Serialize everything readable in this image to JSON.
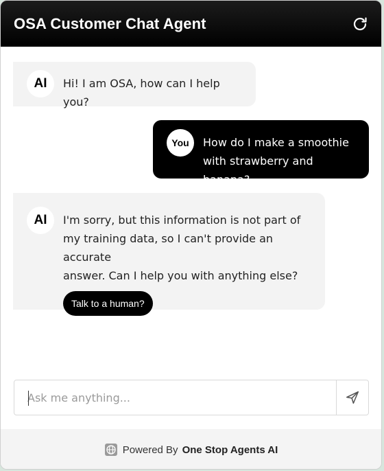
{
  "header": {
    "title": "OSA Customer Chat Agent",
    "refresh_icon": "refresh-icon"
  },
  "messages": [
    {
      "role": "ai",
      "avatar": "AI",
      "text": "Hi! I am OSA, how can I help you?"
    },
    {
      "role": "user",
      "avatar": "You",
      "lines": [
        "How do I make a smoothie",
        "with strawberry and banana?"
      ]
    },
    {
      "role": "ai",
      "avatar": "AI",
      "lines": [
        "I'm sorry, but this information is not part of",
        "my training data, so I can't provide an accurate",
        "answer. Can I help you with anything else?"
      ],
      "action_label": "Talk to a human?"
    }
  ],
  "input": {
    "placeholder": "Ask me anything...",
    "value": "",
    "send_icon": "send-icon"
  },
  "footer": {
    "prefix": "Powered By",
    "brand": "One Stop Agents AI",
    "logo_icon": "globe-logo-icon"
  },
  "colors": {
    "header_bg": "#000000",
    "ai_bubble_bg": "#f3f3f3",
    "user_bubble_bg": "#000000",
    "footer_bg": "#f4f4f4"
  }
}
